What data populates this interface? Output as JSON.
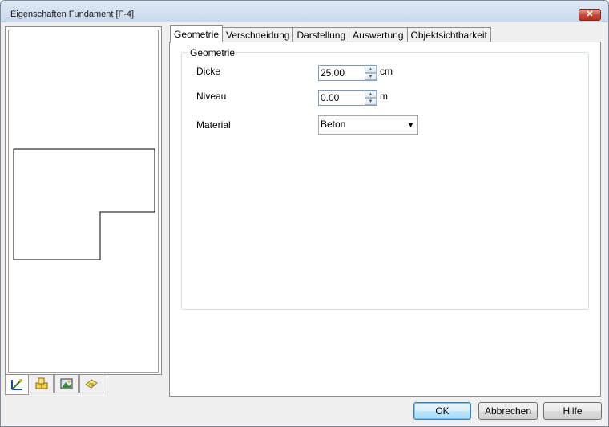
{
  "window": {
    "title": "Eigenschaften Fundament [F-4]",
    "close_glyph": "✕"
  },
  "tabs": [
    {
      "label": "Geometrie",
      "active": true
    },
    {
      "label": "Verschneidung",
      "active": false
    },
    {
      "label": "Darstellung",
      "active": false
    },
    {
      "label": "Auswertung",
      "active": false
    },
    {
      "label": "Objektsichtbarkeit",
      "active": false
    }
  ],
  "geometry_group": {
    "legend": "Geometrie",
    "dicke": {
      "label": "Dicke",
      "value": "25.00",
      "unit": "cm"
    },
    "niveau": {
      "label": "Niveau",
      "value": "0.00",
      "unit": "m"
    },
    "material": {
      "label": "Material",
      "value": "Beton"
    }
  },
  "side_tabs": [
    {
      "icon": "geometry-view-icon"
    },
    {
      "icon": "objects-icon"
    },
    {
      "icon": "image-icon"
    },
    {
      "icon": "layers-icon"
    }
  ],
  "buttons": {
    "ok": "OK",
    "cancel": "Abbrechen",
    "help": "Hilfe"
  },
  "colors": {
    "title_gradient": "#dfe9f5",
    "close_red": "#c44535",
    "default_button": "#3c7fb1"
  }
}
